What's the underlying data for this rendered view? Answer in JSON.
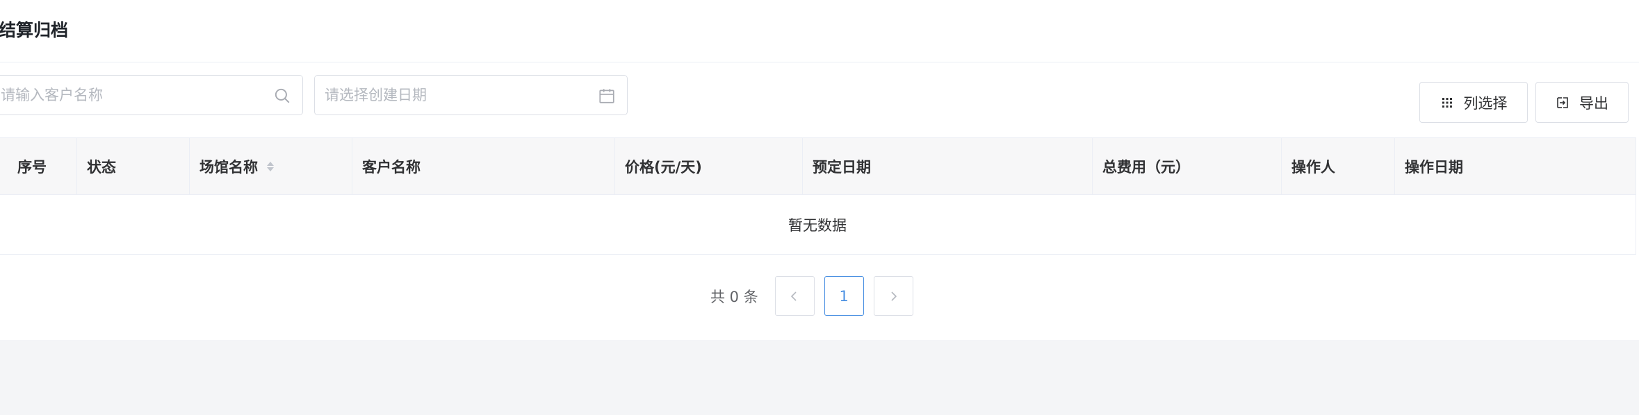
{
  "page": {
    "title": "结算归档"
  },
  "filters": {
    "customer_search_placeholder": "请输入客户名称",
    "customer_search_value": "",
    "created_date_placeholder": "请选择创建日期",
    "created_date_value": ""
  },
  "toolbar": {
    "column_select_label": "列选择",
    "export_label": "导出"
  },
  "table": {
    "columns": [
      {
        "label": "序号"
      },
      {
        "label": "状态"
      },
      {
        "label": "场馆名称",
        "sortable": true
      },
      {
        "label": "客户名称"
      },
      {
        "label": "价格(元/天)"
      },
      {
        "label": "预定日期"
      },
      {
        "label": "总费用（元）"
      },
      {
        "label": "操作人"
      },
      {
        "label": "操作日期"
      }
    ],
    "rows": [],
    "empty_text": "暂无数据"
  },
  "pagination": {
    "total_text": "共 0 条",
    "current_page": "1"
  },
  "colors": {
    "accent": "#4a90e2",
    "header_bg": "#f7f7f8",
    "border": "#dcdfe6",
    "background": "#f4f5f7"
  },
  "icons": {
    "search": "search-icon",
    "calendar": "calendar-icon",
    "column_select": "grid-icon",
    "export": "export-icon",
    "sort": "sort-icon",
    "prev": "chevron-left-icon",
    "next": "chevron-right-icon"
  }
}
